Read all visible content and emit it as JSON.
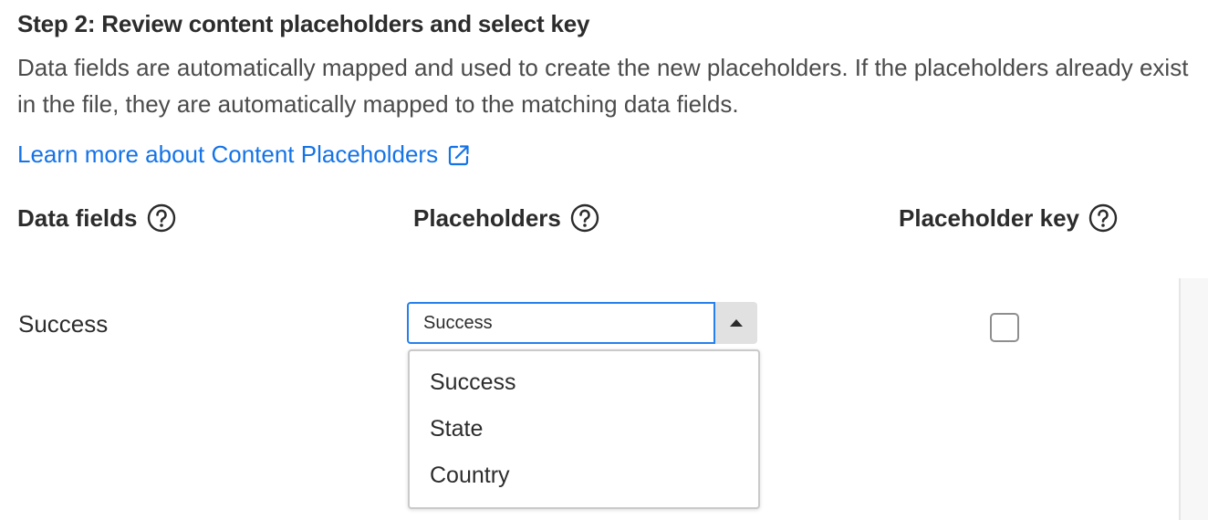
{
  "step": {
    "title": "Step 2: Review content placeholders and select key",
    "description": "Data fields are automatically mapped and used to create the new placeholders. If the placeholders already exist in the file, they are automatically mapped to the matching data fields.",
    "learn_more_link": "Learn more about Content Placeholders"
  },
  "columns": {
    "data_fields": "Data fields",
    "placeholders": "Placeholders",
    "placeholder_key": "Placeholder key"
  },
  "row": {
    "data_field": "Success",
    "selected_placeholder": "Success",
    "key_checked": false
  },
  "dropdown": {
    "options": [
      "Success",
      "State",
      "Country"
    ]
  },
  "colors": {
    "link": "#1473e6",
    "focus_border": "#2680eb"
  },
  "icons": {
    "external_link": "external-link-icon",
    "help": "help-icon",
    "dropdown_arrow": "arrow-up-icon"
  }
}
